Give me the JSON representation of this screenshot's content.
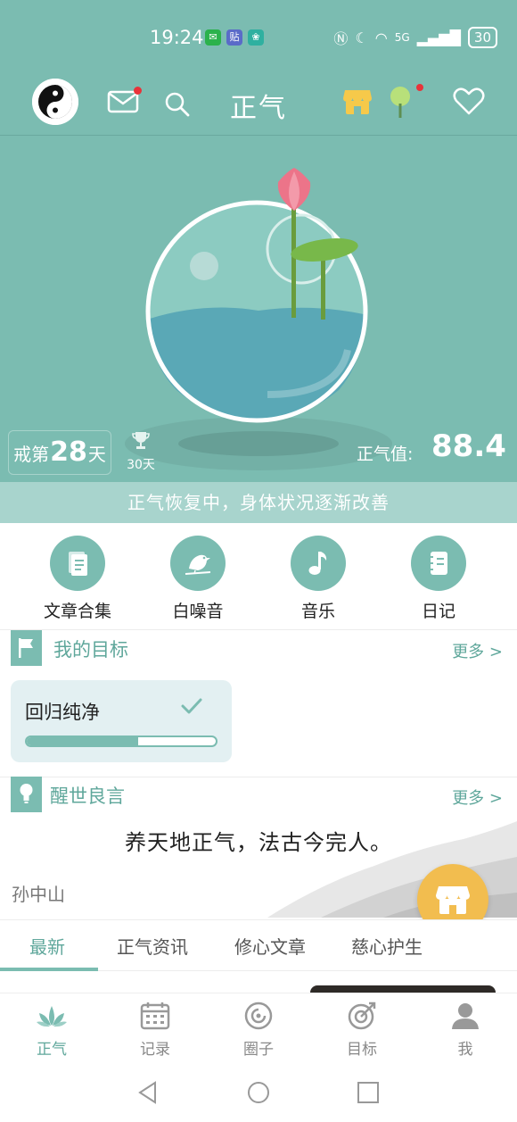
{
  "status_bar": {
    "time": "19:24",
    "apps": [
      "wechat",
      "贴",
      "lotus"
    ],
    "network": "5G",
    "battery": "30"
  },
  "header": {
    "title": "正气",
    "icons": [
      "yin-yang-logo",
      "mail-icon",
      "search-icon",
      "shop-icon",
      "tree-icon",
      "heart-icon"
    ]
  },
  "hero": {
    "streak_prefix": "戒第",
    "streak_days": "28",
    "streak_unit": "天",
    "trophy_label": "30天",
    "zhengqi_label": "正气值:",
    "zhengqi_value": "88.4",
    "status_text": "正气恢复中，身体状况逐渐改善"
  },
  "quick_actions": [
    {
      "label": "文章合集",
      "icon": "document-icon"
    },
    {
      "label": "白噪音",
      "icon": "bird-icon"
    },
    {
      "label": "音乐",
      "icon": "music-note-icon"
    },
    {
      "label": "日记",
      "icon": "notebook-icon"
    }
  ],
  "goals": {
    "title": "我的目标",
    "more": "更多 >",
    "items": [
      {
        "name": "回归纯净",
        "progress": 0.59
      }
    ]
  },
  "quotes": {
    "title": "醒世良言",
    "more": "更多 >",
    "text": "养天地正气，法古今完人。",
    "author": "孙中山"
  },
  "tabs": [
    "最新",
    "正气资讯",
    "修心文章",
    "慈心护生"
  ],
  "active_tab": "最新",
  "bottom_nav": [
    {
      "label": "正气",
      "icon": "lotus-icon",
      "active": true
    },
    {
      "label": "记录",
      "icon": "calendar-icon",
      "active": false
    },
    {
      "label": "圈子",
      "icon": "circle-icon",
      "active": false
    },
    {
      "label": "目标",
      "icon": "target-icon",
      "active": false
    },
    {
      "label": "我",
      "icon": "user-icon",
      "active": false
    }
  ],
  "colors": {
    "primary": "#7bbcb1",
    "accent_text": "#5fa79b",
    "strip": "#a8d4cd",
    "fab": "#f2bd4f",
    "badge": "#e8333a"
  }
}
